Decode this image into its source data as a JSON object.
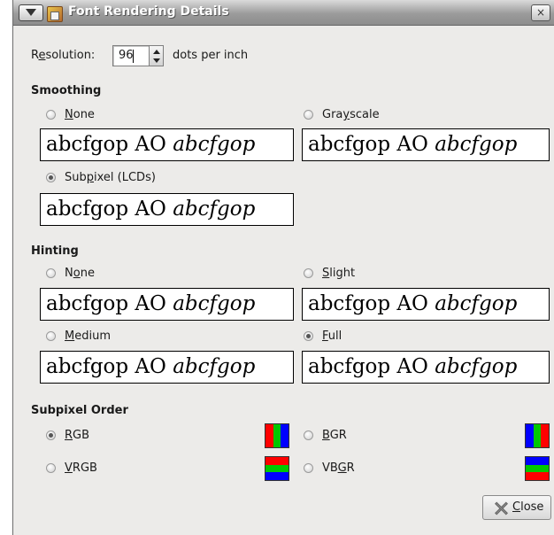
{
  "window": {
    "title": "Font Rendering Details",
    "close_glyph": "×"
  },
  "resolution": {
    "label_prefix": "R",
    "label_mnemonic": "e",
    "label_suffix": "solution:",
    "value": "96",
    "units": "dots per inch"
  },
  "smoothing": {
    "heading": "Smoothing",
    "options": [
      {
        "pre": "",
        "mn": "N",
        "post": "one",
        "selected": false
      },
      {
        "pre": "Gra",
        "mn": "y",
        "post": "scale",
        "selected": false
      },
      {
        "pre": "Sub",
        "mn": "p",
        "post": "ixel (LCDs)",
        "selected": true
      }
    ]
  },
  "hinting": {
    "heading": "Hinting",
    "options": [
      {
        "pre": "N",
        "mn": "o",
        "post": "ne",
        "selected": false
      },
      {
        "pre": "",
        "mn": "S",
        "post": "light",
        "selected": false
      },
      {
        "pre": "",
        "mn": "M",
        "post": "edium",
        "selected": false
      },
      {
        "pre": "",
        "mn": "F",
        "post": "ull",
        "selected": true
      }
    ]
  },
  "sample": {
    "roman": "abcfgop AO ",
    "italic": "abcfgop"
  },
  "subpixel_order": {
    "heading": "Subpixel Order",
    "options": [
      {
        "pre": "",
        "mn": "R",
        "post": "GB",
        "selected": true,
        "colors": [
          "#ff0000",
          "#00c800",
          "#0000ff"
        ]
      },
      {
        "pre": "",
        "mn": "B",
        "post": "GR",
        "selected": false,
        "colors": [
          "#0000ff",
          "#00c800",
          "#ff0000"
        ]
      },
      {
        "pre": "",
        "mn": "V",
        "post": "RGB",
        "selected": false,
        "colors": [
          "#ff0000",
          "#00c800",
          "#0000ff"
        ]
      },
      {
        "pre": "VB",
        "mn": "G",
        "post": "R",
        "selected": false,
        "colors": [
          "#0000ff",
          "#00c800",
          "#ff0000"
        ]
      }
    ]
  },
  "close_button": {
    "mn": "C",
    "post": "lose"
  }
}
